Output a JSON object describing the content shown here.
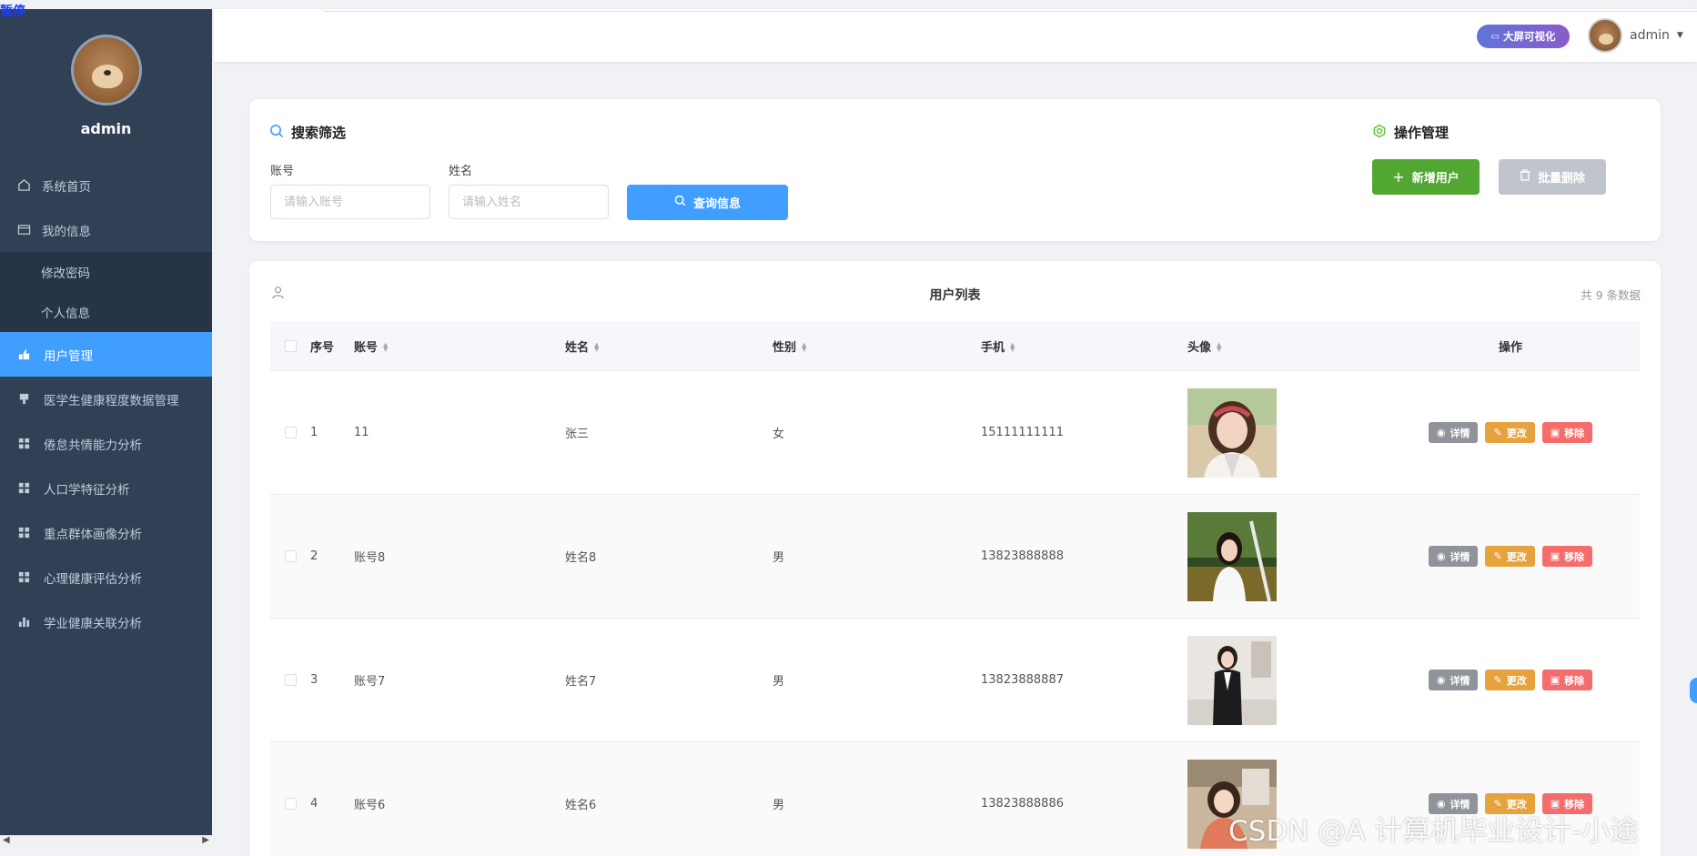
{
  "corner_glyph": "暂停",
  "sidebar": {
    "username": "admin",
    "items": [
      {
        "label": "系统首页",
        "icon": "home-icon",
        "type": "item"
      },
      {
        "label": "我的信息",
        "icon": "card-icon",
        "type": "item"
      },
      {
        "label": "修改密码",
        "type": "sub"
      },
      {
        "label": "个人信息",
        "type": "sub"
      },
      {
        "label": "用户管理",
        "icon": "user-manage-icon",
        "type": "active"
      },
      {
        "label": "医学生健康程度数据管理",
        "icon": "data-icon",
        "type": "item"
      },
      {
        "label": "倦怠共情能力分析",
        "icon": "grid-icon",
        "type": "item"
      },
      {
        "label": "人口学特征分析",
        "icon": "grid-icon",
        "type": "item"
      },
      {
        "label": "重点群体画像分析",
        "icon": "grid-icon",
        "type": "item"
      },
      {
        "label": "心理健康评估分析",
        "icon": "grid-icon",
        "type": "item"
      },
      {
        "label": "学业健康关联分析",
        "icon": "bar-chart-icon",
        "type": "item"
      }
    ]
  },
  "header": {
    "bigscreen_label": "大屏可视化",
    "username": "admin"
  },
  "search": {
    "title": "搜索筛选",
    "account_label": "账号",
    "account_placeholder": "请输入账号",
    "name_label": "姓名",
    "name_placeholder": "请输入姓名",
    "query_label": "查询信息",
    "ops_title": "操作管理",
    "add_label": "新增用户",
    "batch_delete_label": "批量删除"
  },
  "table": {
    "title": "用户列表",
    "count_text": "共 9 条数据",
    "headers": {
      "index": "序号",
      "account": "账号",
      "name": "姓名",
      "gender": "性别",
      "phone": "手机",
      "avatar": "头像",
      "ops": "操作"
    },
    "rows": [
      {
        "index": "1",
        "account": "11",
        "name": "张三",
        "gender": "女",
        "phone": "15111111111"
      },
      {
        "index": "2",
        "account": "账号8",
        "name": "姓名8",
        "gender": "男",
        "phone": "13823888888"
      },
      {
        "index": "3",
        "account": "账号7",
        "name": "姓名7",
        "gender": "男",
        "phone": "13823888887"
      },
      {
        "index": "4",
        "account": "账号6",
        "name": "姓名6",
        "gender": "男",
        "phone": "13823888886"
      }
    ],
    "op_labels": {
      "detail": "详情",
      "edit": "更改",
      "delete": "移除"
    }
  },
  "watermark": "CSDN @A 计算机毕业设计-小途",
  "colors": {
    "sidebar_bg": "#304156",
    "active": "#409eff",
    "add": "#52a732",
    "edit": "#e6a23c",
    "delete": "#f56c6c",
    "detail": "#909399"
  }
}
